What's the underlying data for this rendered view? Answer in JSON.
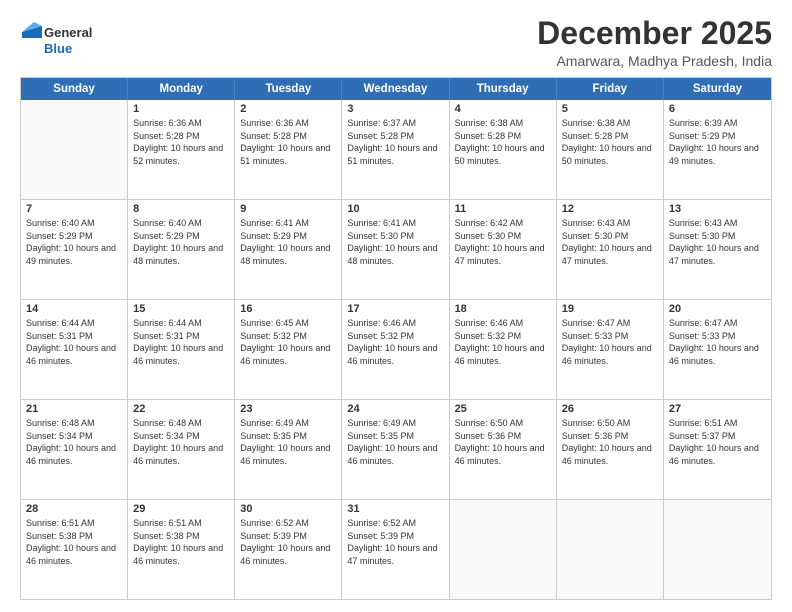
{
  "logo": {
    "line1": "General",
    "line2": "Blue"
  },
  "title": "December 2025",
  "subtitle": "Amarwara, Madhya Pradesh, India",
  "headers": [
    "Sunday",
    "Monday",
    "Tuesday",
    "Wednesday",
    "Thursday",
    "Friday",
    "Saturday"
  ],
  "weeks": [
    [
      {
        "day": "",
        "sunrise": "",
        "sunset": "",
        "daylight": ""
      },
      {
        "day": "1",
        "sunrise": "Sunrise: 6:36 AM",
        "sunset": "Sunset: 5:28 PM",
        "daylight": "Daylight: 10 hours and 52 minutes."
      },
      {
        "day": "2",
        "sunrise": "Sunrise: 6:36 AM",
        "sunset": "Sunset: 5:28 PM",
        "daylight": "Daylight: 10 hours and 51 minutes."
      },
      {
        "day": "3",
        "sunrise": "Sunrise: 6:37 AM",
        "sunset": "Sunset: 5:28 PM",
        "daylight": "Daylight: 10 hours and 51 minutes."
      },
      {
        "day": "4",
        "sunrise": "Sunrise: 6:38 AM",
        "sunset": "Sunset: 5:28 PM",
        "daylight": "Daylight: 10 hours and 50 minutes."
      },
      {
        "day": "5",
        "sunrise": "Sunrise: 6:38 AM",
        "sunset": "Sunset: 5:28 PM",
        "daylight": "Daylight: 10 hours and 50 minutes."
      },
      {
        "day": "6",
        "sunrise": "Sunrise: 6:39 AM",
        "sunset": "Sunset: 5:29 PM",
        "daylight": "Daylight: 10 hours and 49 minutes."
      }
    ],
    [
      {
        "day": "7",
        "sunrise": "Sunrise: 6:40 AM",
        "sunset": "Sunset: 5:29 PM",
        "daylight": "Daylight: 10 hours and 49 minutes."
      },
      {
        "day": "8",
        "sunrise": "Sunrise: 6:40 AM",
        "sunset": "Sunset: 5:29 PM",
        "daylight": "Daylight: 10 hours and 48 minutes."
      },
      {
        "day": "9",
        "sunrise": "Sunrise: 6:41 AM",
        "sunset": "Sunset: 5:29 PM",
        "daylight": "Daylight: 10 hours and 48 minutes."
      },
      {
        "day": "10",
        "sunrise": "Sunrise: 6:41 AM",
        "sunset": "Sunset: 5:30 PM",
        "daylight": "Daylight: 10 hours and 48 minutes."
      },
      {
        "day": "11",
        "sunrise": "Sunrise: 6:42 AM",
        "sunset": "Sunset: 5:30 PM",
        "daylight": "Daylight: 10 hours and 47 minutes."
      },
      {
        "day": "12",
        "sunrise": "Sunrise: 6:43 AM",
        "sunset": "Sunset: 5:30 PM",
        "daylight": "Daylight: 10 hours and 47 minutes."
      },
      {
        "day": "13",
        "sunrise": "Sunrise: 6:43 AM",
        "sunset": "Sunset: 5:30 PM",
        "daylight": "Daylight: 10 hours and 47 minutes."
      }
    ],
    [
      {
        "day": "14",
        "sunrise": "Sunrise: 6:44 AM",
        "sunset": "Sunset: 5:31 PM",
        "daylight": "Daylight: 10 hours and 46 minutes."
      },
      {
        "day": "15",
        "sunrise": "Sunrise: 6:44 AM",
        "sunset": "Sunset: 5:31 PM",
        "daylight": "Daylight: 10 hours and 46 minutes."
      },
      {
        "day": "16",
        "sunrise": "Sunrise: 6:45 AM",
        "sunset": "Sunset: 5:32 PM",
        "daylight": "Daylight: 10 hours and 46 minutes."
      },
      {
        "day": "17",
        "sunrise": "Sunrise: 6:46 AM",
        "sunset": "Sunset: 5:32 PM",
        "daylight": "Daylight: 10 hours and 46 minutes."
      },
      {
        "day": "18",
        "sunrise": "Sunrise: 6:46 AM",
        "sunset": "Sunset: 5:32 PM",
        "daylight": "Daylight: 10 hours and 46 minutes."
      },
      {
        "day": "19",
        "sunrise": "Sunrise: 6:47 AM",
        "sunset": "Sunset: 5:33 PM",
        "daylight": "Daylight: 10 hours and 46 minutes."
      },
      {
        "day": "20",
        "sunrise": "Sunrise: 6:47 AM",
        "sunset": "Sunset: 5:33 PM",
        "daylight": "Daylight: 10 hours and 46 minutes."
      }
    ],
    [
      {
        "day": "21",
        "sunrise": "Sunrise: 6:48 AM",
        "sunset": "Sunset: 5:34 PM",
        "daylight": "Daylight: 10 hours and 46 minutes."
      },
      {
        "day": "22",
        "sunrise": "Sunrise: 6:48 AM",
        "sunset": "Sunset: 5:34 PM",
        "daylight": "Daylight: 10 hours and 46 minutes."
      },
      {
        "day": "23",
        "sunrise": "Sunrise: 6:49 AM",
        "sunset": "Sunset: 5:35 PM",
        "daylight": "Daylight: 10 hours and 46 minutes."
      },
      {
        "day": "24",
        "sunrise": "Sunrise: 6:49 AM",
        "sunset": "Sunset: 5:35 PM",
        "daylight": "Daylight: 10 hours and 46 minutes."
      },
      {
        "day": "25",
        "sunrise": "Sunrise: 6:50 AM",
        "sunset": "Sunset: 5:36 PM",
        "daylight": "Daylight: 10 hours and 46 minutes."
      },
      {
        "day": "26",
        "sunrise": "Sunrise: 6:50 AM",
        "sunset": "Sunset: 5:36 PM",
        "daylight": "Daylight: 10 hours and 46 minutes."
      },
      {
        "day": "27",
        "sunrise": "Sunrise: 6:51 AM",
        "sunset": "Sunset: 5:37 PM",
        "daylight": "Daylight: 10 hours and 46 minutes."
      }
    ],
    [
      {
        "day": "28",
        "sunrise": "Sunrise: 6:51 AM",
        "sunset": "Sunset: 5:38 PM",
        "daylight": "Daylight: 10 hours and 46 minutes."
      },
      {
        "day": "29",
        "sunrise": "Sunrise: 6:51 AM",
        "sunset": "Sunset: 5:38 PM",
        "daylight": "Daylight: 10 hours and 46 minutes."
      },
      {
        "day": "30",
        "sunrise": "Sunrise: 6:52 AM",
        "sunset": "Sunset: 5:39 PM",
        "daylight": "Daylight: 10 hours and 46 minutes."
      },
      {
        "day": "31",
        "sunrise": "Sunrise: 6:52 AM",
        "sunset": "Sunset: 5:39 PM",
        "daylight": "Daylight: 10 hours and 47 minutes."
      },
      {
        "day": "",
        "sunrise": "",
        "sunset": "",
        "daylight": ""
      },
      {
        "day": "",
        "sunrise": "",
        "sunset": "",
        "daylight": ""
      },
      {
        "day": "",
        "sunrise": "",
        "sunset": "",
        "daylight": ""
      }
    ]
  ]
}
